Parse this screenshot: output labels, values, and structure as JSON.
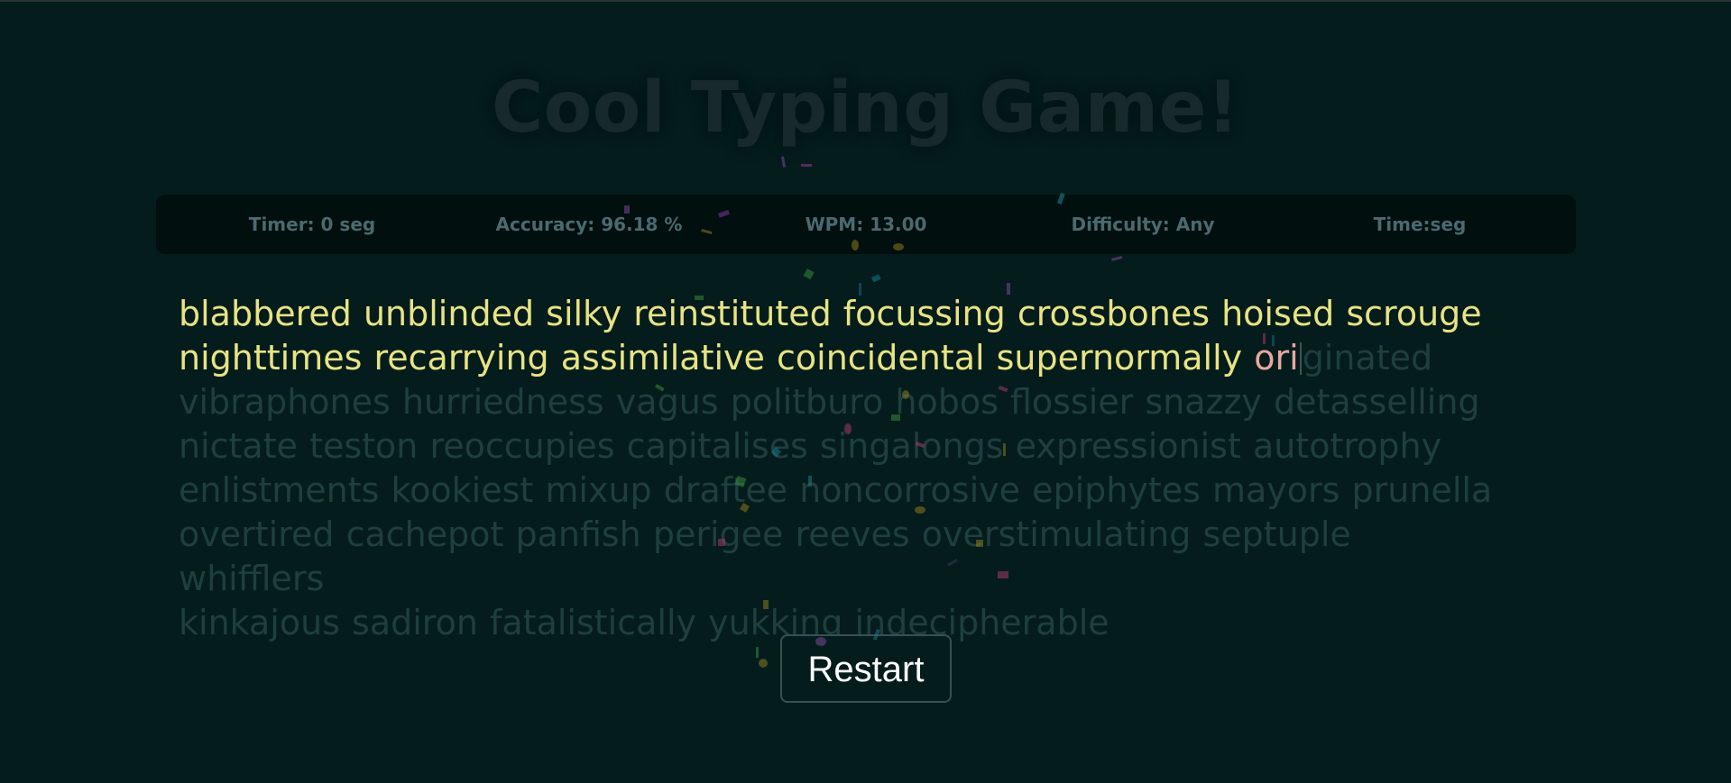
{
  "title": "Cool Typing Game!",
  "stats": {
    "timer": "Timer: 0 seg",
    "accuracy": "Accuracy: 96.18 %",
    "wpm": "WPM: 13.00",
    "difficulty": "Difficulty: Any",
    "time": "Time:seg"
  },
  "text": {
    "typed_line1": "blabbered unblinded silky reinstituted focussing crossbones hoised scrouge",
    "typed_line2": "nighttimes recarrying assimilative coincidental supernormally ",
    "typed_wrong": "ori",
    "remaining_line2": "ginated",
    "line3": "vibraphones hurriedness vagus politburo hobos flossier snazzy detasselling",
    "line4": "nictate teston reoccupies capitalises singalongs expressionist autotrophy",
    "line5": "enlistments kookiest mixup draftee noncorrosive epiphytes mayors prunella",
    "line6": "overtired cachepot panfish perigee reeves overstimulating septuple whifflers",
    "line7": "kinkajous sadiron fatalistically yukking indecipherable"
  },
  "restart_label": "Restart",
  "colors": {
    "background": "#041c1c",
    "typed": "#e8e383",
    "wrong": "#e8a8a0",
    "untyped": "#1f3e3e",
    "stats_bar": "#010f0f"
  }
}
